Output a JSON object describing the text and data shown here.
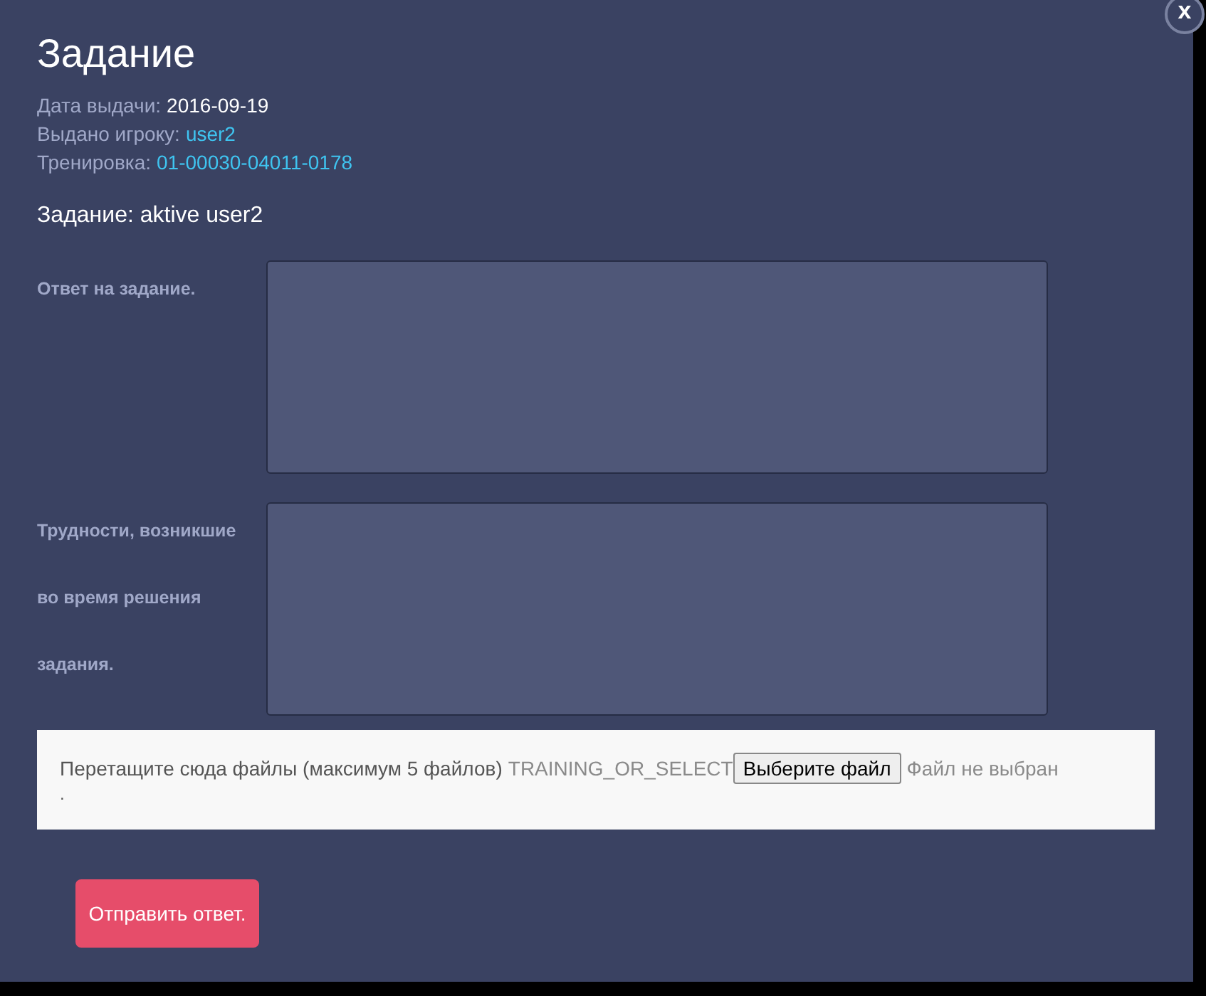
{
  "window": {
    "title": "Задание",
    "close": "x"
  },
  "meta": [
    {
      "label": "Дата выдачи:",
      "value": "2016-09-19",
      "kind": "text"
    },
    {
      "label": "Выдано игроку:",
      "value": "user2",
      "kind": "link"
    },
    {
      "label": "Тренировка:",
      "value": "01-00030-04011-0178",
      "kind": "link"
    }
  ],
  "task": "Задание: aktive user2",
  "fields": [
    {
      "label": "Ответ на задание."
    },
    {
      "label": "Трудности, возникшие во время решения задания."
    }
  ],
  "upload": {
    "hint": "Перетащите сюда файлы (максимум 5 файлов)",
    "hidden_text": "TRAINING_OR_SELECT",
    "button": "Выберите файл",
    "status": "Файл не выбран",
    "dot": "."
  },
  "submit": "Отправить ответ."
}
